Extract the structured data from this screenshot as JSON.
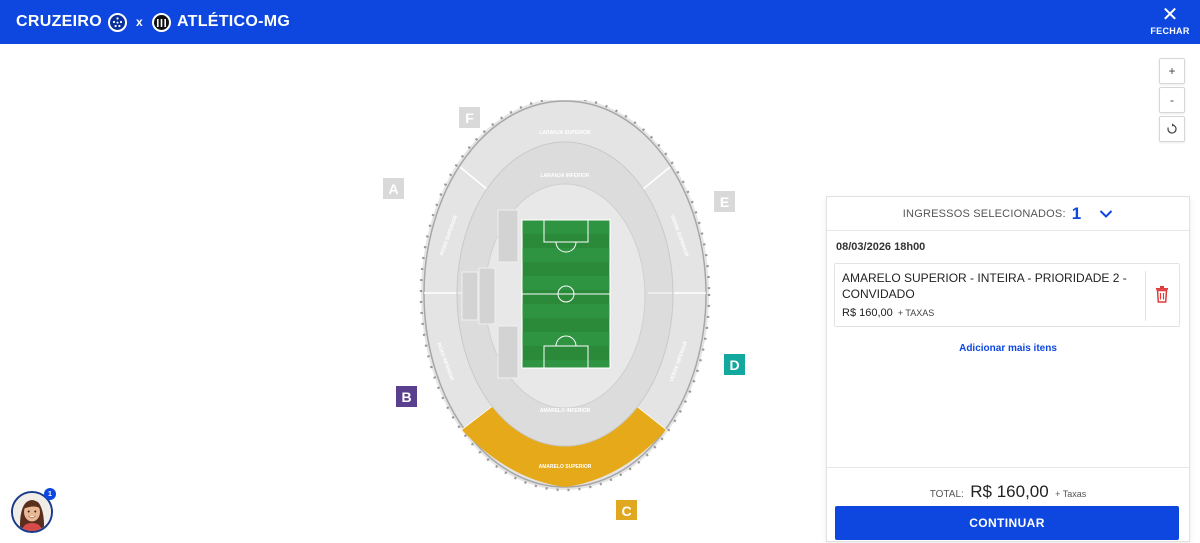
{
  "header": {
    "team_home": "CRUZEIRO",
    "vs": "x",
    "team_away": "ATLÉTICO-MG",
    "close_label": "FECHAR",
    "bg_color": "#0d47e0"
  },
  "zoom_controls": {
    "zoom_in": "+",
    "zoom_out": "-",
    "reset_icon": "rotate-icon"
  },
  "stadium": {
    "gates": [
      {
        "label": "F",
        "color": "#d9d9d9"
      },
      {
        "label": "A",
        "color": "#d9d9d9"
      },
      {
        "label": "E",
        "color": "#d9d9d9"
      },
      {
        "label": "B",
        "color": "#5b3f8f"
      },
      {
        "label": "D",
        "color": "#13a89e"
      },
      {
        "label": "C",
        "color": "#e0a81f"
      }
    ],
    "sectors": {
      "laranja_superior": "LARANJA SUPERIOR",
      "laranja_inferior": "LARANJA INFERIOR",
      "amarelo_inferior": "AMARELO INFERIOR",
      "amarelo_superior": "AMARELO SUPERIOR",
      "roxo_superior": "ROXO SUPERIOR",
      "verde_superior": "VERDE SUPERIOR",
      "roxo_inferior": "ROXO INFERIOR",
      "verde_inferior": "VERDE INFERIOR",
      "selected_color": "#e6a91a"
    }
  },
  "cart": {
    "header_label": "INGRESSOS SELECIONADOS:",
    "count": "1",
    "date": "08/03/2026 18h00",
    "ticket": {
      "name": "AMARELO SUPERIOR - INTEIRA - PRIORIDADE 2 - CONVIDADO",
      "price": "R$ 160,00",
      "tax": "+ TAXAS"
    },
    "add_more": "Adicionar mais itens",
    "total_label": "TOTAL:",
    "total_value": "R$ 160,00",
    "total_tax": "+ Taxas",
    "continue_label": "CONTINUAR"
  },
  "assistant": {
    "badge": "1"
  }
}
